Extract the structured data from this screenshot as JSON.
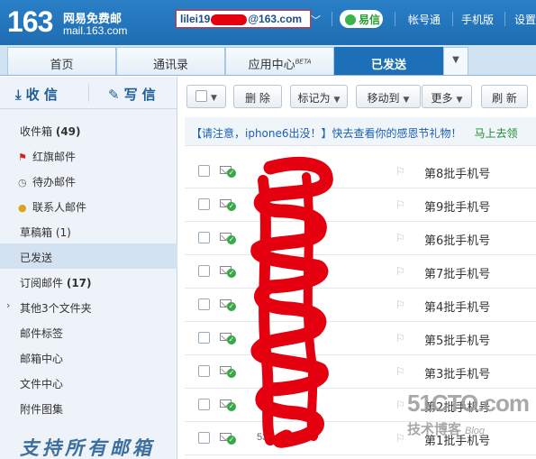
{
  "header": {
    "logo_number": "163",
    "logo_title": "网易免费邮",
    "logo_url": "mail.163.com",
    "account_prefix": "lilei19",
    "account_suffix": "@163.com",
    "yixin_label": "易信",
    "links": [
      "帐号通",
      "手机版",
      "设置"
    ]
  },
  "tabs": {
    "items": [
      "首页",
      "通讯录",
      "应用中心",
      "已发送"
    ],
    "beta_label": "BETA",
    "active": "已发送"
  },
  "sidebar": {
    "receive_label": "收 信",
    "write_label": "写 信",
    "folders": [
      {
        "label": "收件箱",
        "count": "(49)"
      },
      {
        "label": "红旗邮件",
        "count": ""
      },
      {
        "label": "待办邮件",
        "count": ""
      },
      {
        "label": "联系人邮件",
        "count": ""
      },
      {
        "label": "草稿箱",
        "count": "(1)"
      },
      {
        "label": "已发送",
        "count": ""
      },
      {
        "label": "订阅邮件",
        "count": "(17)"
      },
      {
        "label": "其他3个文件夹",
        "count": ""
      },
      {
        "label": "邮件标签",
        "count": ""
      },
      {
        "label": "邮箱中心",
        "count": ""
      },
      {
        "label": "文件中心",
        "count": ""
      },
      {
        "label": "附件图集",
        "count": ""
      }
    ],
    "promo_text": "支持所有邮箱"
  },
  "toolbar": {
    "delete_label": "删 除",
    "mark_label": "标记为",
    "move_label": "移动到",
    "more_label": "更多",
    "refresh_label": "刷 新"
  },
  "notice": {
    "message": "【请注意，iphone6出没！】快去查看你的感恩节礼物！",
    "action": "马上去领"
  },
  "mails": [
    {
      "recipient": "",
      "subject": "第8批手机号"
    },
    {
      "recipient": "",
      "subject": "第9批手机号"
    },
    {
      "recipient": "",
      "subject": "第6批手机号"
    },
    {
      "recipient": "",
      "subject": "第7批手机号"
    },
    {
      "recipient": "",
      "subject": "第4批手机号"
    },
    {
      "recipient": "",
      "subject": "第5批手机号"
    },
    {
      "recipient": "",
      "subject": "第3批手机号"
    },
    {
      "recipient": "",
      "subject": "第2批手机号"
    },
    {
      "recipient": "535",
      "subject": "第1批手机号"
    }
  ],
  "watermark": {
    "site": "51CTO.com",
    "tagline": "技术博客",
    "blog": "Blog"
  },
  "colors": {
    "header_blue": "#1e6db3",
    "active_tab": "#1d6fb8",
    "redaction_red": "#e4000f",
    "notice_green": "#1f8a2f"
  }
}
